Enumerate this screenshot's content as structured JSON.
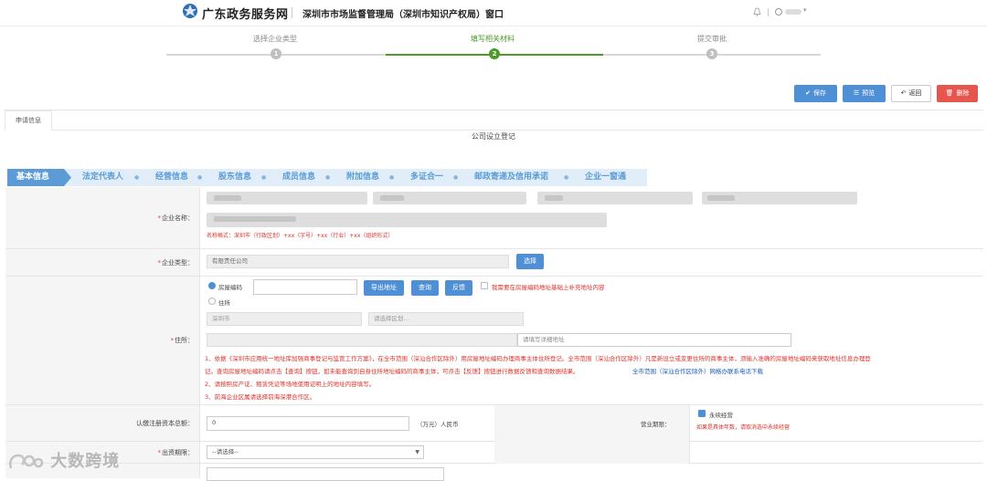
{
  "header": {
    "brand": "广东政务服务网",
    "department": "深圳市市场监督管理局（深圳市知识产权局）窗口"
  },
  "steps": [
    {
      "label": "选择企业类型",
      "num": "1"
    },
    {
      "label": "填写相关材料",
      "num": "2"
    },
    {
      "label": "提交审批",
      "num": "3"
    }
  ],
  "toolbar": {
    "save": "保存",
    "preview": "预览",
    "back": "返回",
    "delete": "删除"
  },
  "tab": {
    "label": "申请信息"
  },
  "form_title": "公司设立登记",
  "subnav": {
    "items": [
      "基本信息",
      "法定代表人",
      "经营信息",
      "股东信息",
      "成员信息",
      "附加信息",
      "多证合一",
      "邮政寄递及信用承诺",
      "企业一窗通"
    ]
  },
  "fields": {
    "company_name": {
      "label": "企业名称：",
      "hint": "名称格式：深圳市（行政区划）+xx（字号）+xx（行业）+xx（组织形式）"
    },
    "company_type": {
      "label": "企业类型：",
      "value": "有限责任公司",
      "button": "选择"
    },
    "address": {
      "label": "住所：",
      "opt_code": "房屋编码",
      "opt_home": "住所",
      "btn_export": "导出地址",
      "btn_query": "查询",
      "btn_feedback": "反馈",
      "supplement": "我需要在房屋编码地址基础上补充地址内容",
      "city": "深圳市",
      "district_placeholder": "请选择区划...",
      "detail_placeholder": "请填写详细地址",
      "note1a": "1、依据《深圳市应用统一地址库加强商事登记与监管工作方案》，在全市范围（深汕合作区除外）用房屋地址编码办理商事主体住所登记。全市范围（深汕合作区除外）凡是新设立或变更住所的商事主体，须输入准确的房屋地址编码来获取地址信息办理登",
      "note1b": "记。查询房屋地址编码请点击【查询】按钮，如未能查询到自身住所地址编码的商事主体，可点击【反馈】按钮进行数据反馈和查询数据结果。",
      "note1c": "全市范围（深汕合作区除外）网格办联系电话下载",
      "note2": "2、请按照房产证、租赁凭证等场地使用证明上的地址内容填写。",
      "note3": "3、前海企业区属请选择前海深港合作区。"
    },
    "capital": {
      "label": "认缴注册资本总额：",
      "value": "0",
      "unit": "（万元）人民币"
    },
    "term": {
      "label": "营业期限：",
      "option": "永续经营",
      "hint": "如果是具体年数，请取消选中永续经营"
    },
    "contribution": {
      "label": "出资期限：",
      "placeholder": "--请选择--"
    }
  },
  "watermark": "大数跨境",
  "colors": {
    "green": "#4c9b2a",
    "blue": "#4f8fd6",
    "red": "#e5564c",
    "nav_bg": "#e1eef9"
  }
}
